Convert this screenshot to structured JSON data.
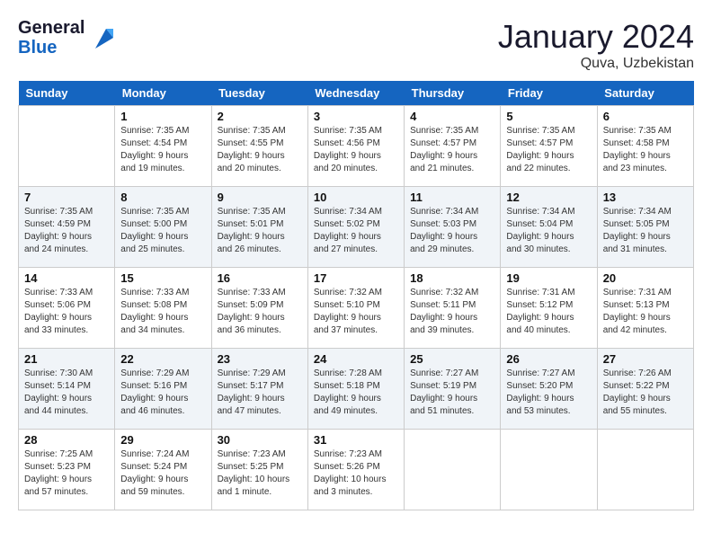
{
  "header": {
    "logo_line1": "General",
    "logo_line2": "Blue",
    "month": "January 2024",
    "location": "Quva, Uzbekistan"
  },
  "weekdays": [
    "Sunday",
    "Monday",
    "Tuesday",
    "Wednesday",
    "Thursday",
    "Friday",
    "Saturday"
  ],
  "weeks": [
    [
      {
        "day": "",
        "sunrise": "",
        "sunset": "",
        "daylight": ""
      },
      {
        "day": "1",
        "sunrise": "Sunrise: 7:35 AM",
        "sunset": "Sunset: 4:54 PM",
        "daylight": "Daylight: 9 hours and 19 minutes."
      },
      {
        "day": "2",
        "sunrise": "Sunrise: 7:35 AM",
        "sunset": "Sunset: 4:55 PM",
        "daylight": "Daylight: 9 hours and 20 minutes."
      },
      {
        "day": "3",
        "sunrise": "Sunrise: 7:35 AM",
        "sunset": "Sunset: 4:56 PM",
        "daylight": "Daylight: 9 hours and 20 minutes."
      },
      {
        "day": "4",
        "sunrise": "Sunrise: 7:35 AM",
        "sunset": "Sunset: 4:57 PM",
        "daylight": "Daylight: 9 hours and 21 minutes."
      },
      {
        "day": "5",
        "sunrise": "Sunrise: 7:35 AM",
        "sunset": "Sunset: 4:57 PM",
        "daylight": "Daylight: 9 hours and 22 minutes."
      },
      {
        "day": "6",
        "sunrise": "Sunrise: 7:35 AM",
        "sunset": "Sunset: 4:58 PM",
        "daylight": "Daylight: 9 hours and 23 minutes."
      }
    ],
    [
      {
        "day": "7",
        "sunrise": "Sunrise: 7:35 AM",
        "sunset": "Sunset: 4:59 PM",
        "daylight": "Daylight: 9 hours and 24 minutes."
      },
      {
        "day": "8",
        "sunrise": "Sunrise: 7:35 AM",
        "sunset": "Sunset: 5:00 PM",
        "daylight": "Daylight: 9 hours and 25 minutes."
      },
      {
        "day": "9",
        "sunrise": "Sunrise: 7:35 AM",
        "sunset": "Sunset: 5:01 PM",
        "daylight": "Daylight: 9 hours and 26 minutes."
      },
      {
        "day": "10",
        "sunrise": "Sunrise: 7:34 AM",
        "sunset": "Sunset: 5:02 PM",
        "daylight": "Daylight: 9 hours and 27 minutes."
      },
      {
        "day": "11",
        "sunrise": "Sunrise: 7:34 AM",
        "sunset": "Sunset: 5:03 PM",
        "daylight": "Daylight: 9 hours and 29 minutes."
      },
      {
        "day": "12",
        "sunrise": "Sunrise: 7:34 AM",
        "sunset": "Sunset: 5:04 PM",
        "daylight": "Daylight: 9 hours and 30 minutes."
      },
      {
        "day": "13",
        "sunrise": "Sunrise: 7:34 AM",
        "sunset": "Sunset: 5:05 PM",
        "daylight": "Daylight: 9 hours and 31 minutes."
      }
    ],
    [
      {
        "day": "14",
        "sunrise": "Sunrise: 7:33 AM",
        "sunset": "Sunset: 5:06 PM",
        "daylight": "Daylight: 9 hours and 33 minutes."
      },
      {
        "day": "15",
        "sunrise": "Sunrise: 7:33 AM",
        "sunset": "Sunset: 5:08 PM",
        "daylight": "Daylight: 9 hours and 34 minutes."
      },
      {
        "day": "16",
        "sunrise": "Sunrise: 7:33 AM",
        "sunset": "Sunset: 5:09 PM",
        "daylight": "Daylight: 9 hours and 36 minutes."
      },
      {
        "day": "17",
        "sunrise": "Sunrise: 7:32 AM",
        "sunset": "Sunset: 5:10 PM",
        "daylight": "Daylight: 9 hours and 37 minutes."
      },
      {
        "day": "18",
        "sunrise": "Sunrise: 7:32 AM",
        "sunset": "Sunset: 5:11 PM",
        "daylight": "Daylight: 9 hours and 39 minutes."
      },
      {
        "day": "19",
        "sunrise": "Sunrise: 7:31 AM",
        "sunset": "Sunset: 5:12 PM",
        "daylight": "Daylight: 9 hours and 40 minutes."
      },
      {
        "day": "20",
        "sunrise": "Sunrise: 7:31 AM",
        "sunset": "Sunset: 5:13 PM",
        "daylight": "Daylight: 9 hours and 42 minutes."
      }
    ],
    [
      {
        "day": "21",
        "sunrise": "Sunrise: 7:30 AM",
        "sunset": "Sunset: 5:14 PM",
        "daylight": "Daylight: 9 hours and 44 minutes."
      },
      {
        "day": "22",
        "sunrise": "Sunrise: 7:29 AM",
        "sunset": "Sunset: 5:16 PM",
        "daylight": "Daylight: 9 hours and 46 minutes."
      },
      {
        "day": "23",
        "sunrise": "Sunrise: 7:29 AM",
        "sunset": "Sunset: 5:17 PM",
        "daylight": "Daylight: 9 hours and 47 minutes."
      },
      {
        "day": "24",
        "sunrise": "Sunrise: 7:28 AM",
        "sunset": "Sunset: 5:18 PM",
        "daylight": "Daylight: 9 hours and 49 minutes."
      },
      {
        "day": "25",
        "sunrise": "Sunrise: 7:27 AM",
        "sunset": "Sunset: 5:19 PM",
        "daylight": "Daylight: 9 hours and 51 minutes."
      },
      {
        "day": "26",
        "sunrise": "Sunrise: 7:27 AM",
        "sunset": "Sunset: 5:20 PM",
        "daylight": "Daylight: 9 hours and 53 minutes."
      },
      {
        "day": "27",
        "sunrise": "Sunrise: 7:26 AM",
        "sunset": "Sunset: 5:22 PM",
        "daylight": "Daylight: 9 hours and 55 minutes."
      }
    ],
    [
      {
        "day": "28",
        "sunrise": "Sunrise: 7:25 AM",
        "sunset": "Sunset: 5:23 PM",
        "daylight": "Daylight: 9 hours and 57 minutes."
      },
      {
        "day": "29",
        "sunrise": "Sunrise: 7:24 AM",
        "sunset": "Sunset: 5:24 PM",
        "daylight": "Daylight: 9 hours and 59 minutes."
      },
      {
        "day": "30",
        "sunrise": "Sunrise: 7:23 AM",
        "sunset": "Sunset: 5:25 PM",
        "daylight": "Daylight: 10 hours and 1 minute."
      },
      {
        "day": "31",
        "sunrise": "Sunrise: 7:23 AM",
        "sunset": "Sunset: 5:26 PM",
        "daylight": "Daylight: 10 hours and 3 minutes."
      },
      {
        "day": "",
        "sunrise": "",
        "sunset": "",
        "daylight": ""
      },
      {
        "day": "",
        "sunrise": "",
        "sunset": "",
        "daylight": ""
      },
      {
        "day": "",
        "sunrise": "",
        "sunset": "",
        "daylight": ""
      }
    ]
  ]
}
